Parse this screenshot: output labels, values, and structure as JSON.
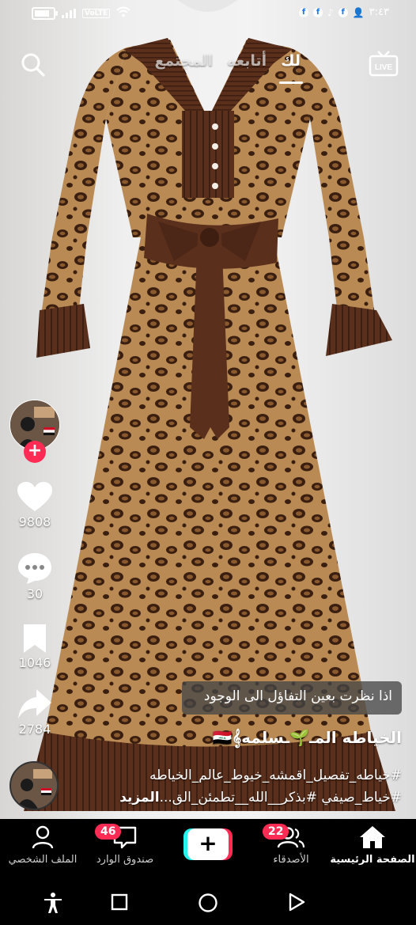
{
  "status_bar": {
    "time": "٣:٤٣",
    "network_label": "VoLTE",
    "notification_icons": [
      "facebook-icon",
      "facebook-icon",
      "tiktok-icon",
      "facebook-icon",
      "person-add-icon"
    ],
    "battery_level": 0.85
  },
  "top_bar": {
    "tabs": [
      {
        "label": "لك",
        "active": true
      },
      {
        "label": "أتابعه",
        "active": false
      },
      {
        "label": "المجتمع",
        "active": false
      }
    ],
    "live_label": "LIVE"
  },
  "actions": {
    "likes": "9808",
    "comments": "30",
    "saves": "1046",
    "shares": "2784"
  },
  "video": {
    "caption_overlay": "اذا نظرت بعين التفاؤل الى الوجود",
    "username": "الخياطه المـ🌱ـسلمه🇮🇶𝄞",
    "description_line1": "#خياطه_تفصيل_اقمشه_خيوط_عالم_الخياطه",
    "description_line2": "#خياط_صيفي #بذكر__الله__تطمئن_الق...",
    "more_label": "المزيد"
  },
  "bottom_nav": {
    "home_label": "الصفحة الرئيسية",
    "friends_label": "الأصدقاء",
    "friends_badge": "22",
    "inbox_label": "صندوق الوارد",
    "inbox_badge": "46",
    "profile_label": "الملف الشخصي"
  },
  "colors": {
    "accent_red": "#fe2c55",
    "accent_cyan": "#25f4ee",
    "dress_brown": "#5a2f1c",
    "leopard_base": "#b78852"
  }
}
